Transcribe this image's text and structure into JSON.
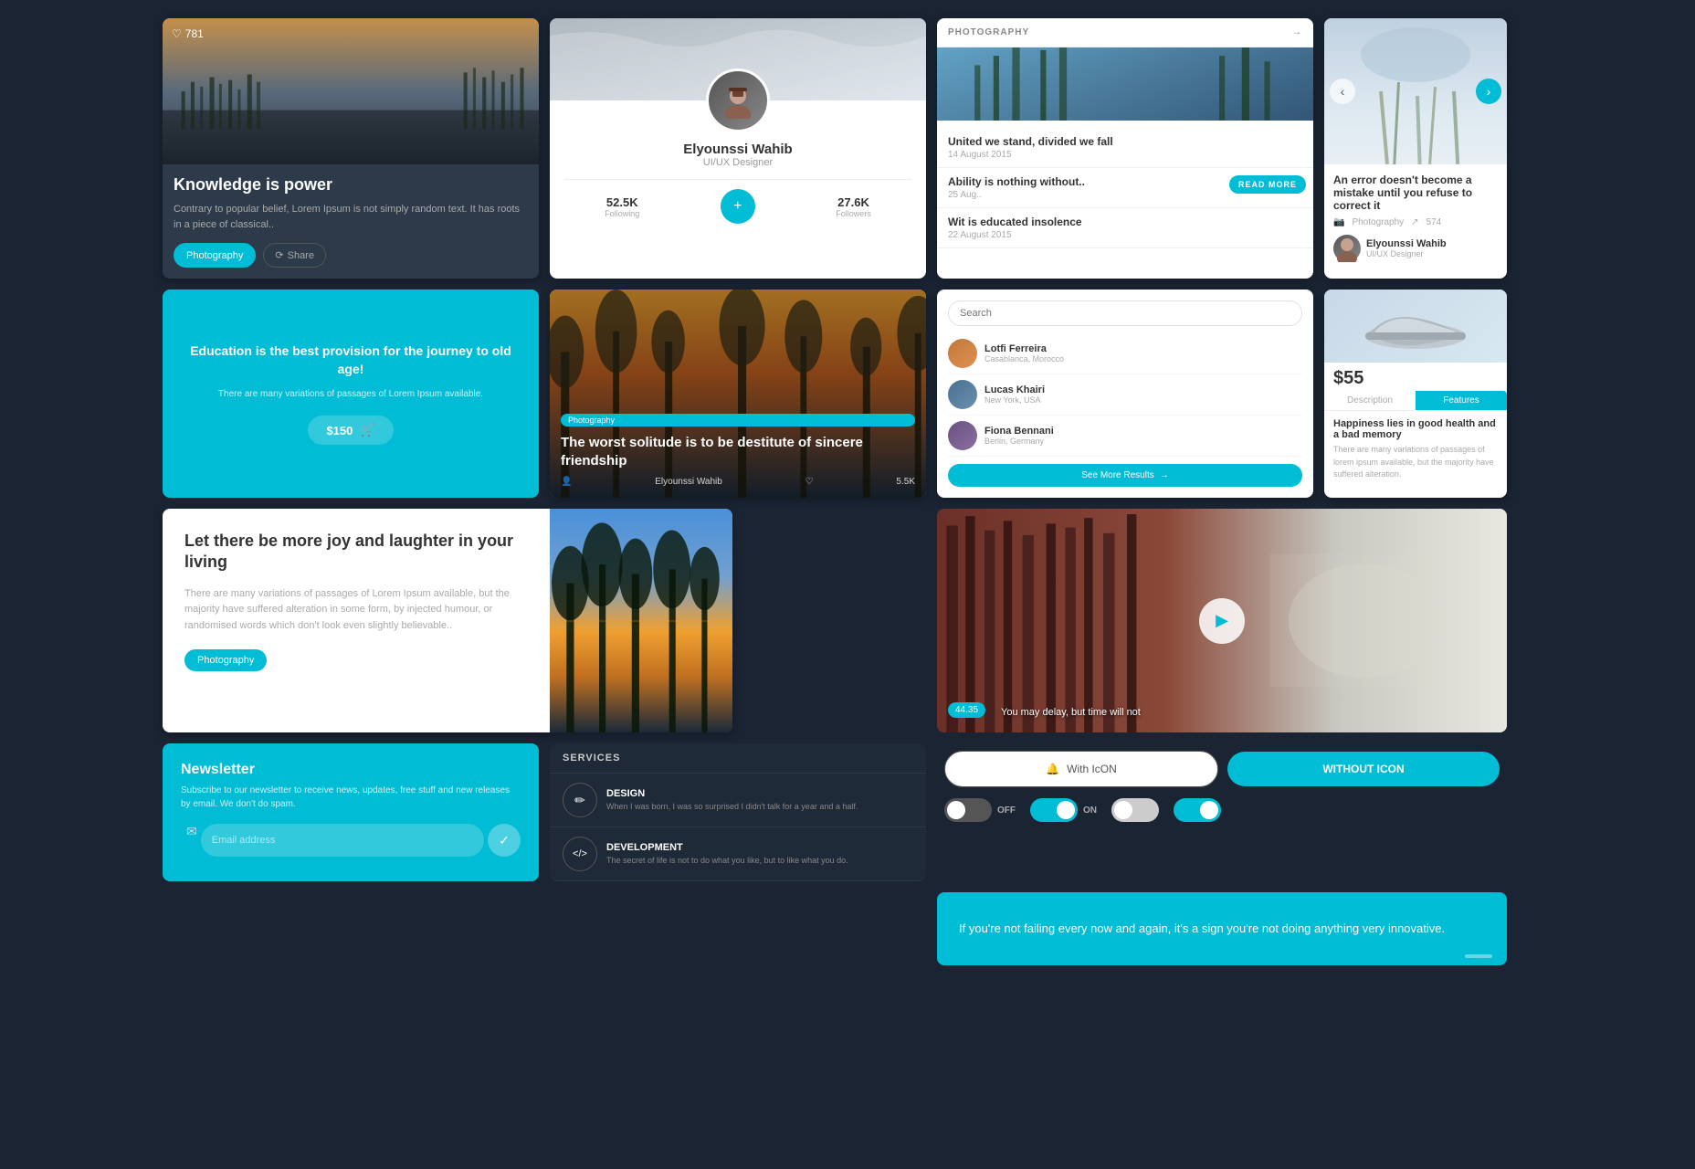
{
  "cards": {
    "knowledge": {
      "heart_count": "781",
      "title": "Knowledge is power",
      "description": "Contrary to popular belief, Lorem Ipsum is not simply random text. It has roots in a piece of classical..",
      "tag_label": "Photography",
      "share_label": "Share"
    },
    "profile": {
      "name": "Elyounssi Wahib",
      "role": "UI/UX Designer",
      "following_count": "52.5K",
      "following_label": "Following",
      "followers_count": "27.6K",
      "followers_label": "Followers"
    },
    "photography": {
      "header": "PHOTOGRAPHY",
      "entries": [
        {
          "title": "United we stand, divided we fall",
          "date": "14 August 2015"
        },
        {
          "title": "Ability is nothing without..",
          "date": "25 Aug.."
        },
        {
          "title": "Wit is educated insolence",
          "date": "22 August 2015"
        }
      ],
      "read_more": "READ MORE"
    },
    "error_card": {
      "title": "An error doesn't become a mistake until you refuse to correct it",
      "category": "Photography",
      "shares": "574",
      "author_name": "Elyounssi Wahib",
      "author_role": "UI/UX Designer"
    },
    "education": {
      "title": "Education is the best provision for the journey to old age!",
      "description": "There are many variations of passages of Lorem Ipsum available.",
      "price": "$150"
    },
    "solitude": {
      "tag": "Photography",
      "title": "The worst solitude is to be destitute of sincere friendship",
      "author": "Elyounssi Wahib",
      "likes": "5.5K"
    },
    "search_card": {
      "placeholder": "Search",
      "users": [
        {
          "name": "Lotfi Ferreira",
          "location": "Casablanca, Morocco"
        },
        {
          "name": "Lucas Khairi",
          "location": "New York, USA"
        },
        {
          "name": "Fiona Bennani",
          "location": "Berlin, Germany"
        }
      ],
      "see_more": "See More Results"
    },
    "product": {
      "price": "$55",
      "tab1": "Description",
      "tab2": "Features",
      "feature_title": "Happiness lies in good health and a bad memory",
      "feature_desc": "There are many variations of passages of lorem ipsum available, but the majority have suffered alteration."
    },
    "joy": {
      "title": "Let there be more joy and laughter in your living",
      "description": "There are many variations of passages of Lorem Ipsum available, but the majority have suffered alteration in some form, by injected humour, or randomised words which don't look even slightly believable..",
      "tag": "Photography"
    },
    "video": {
      "timer": "44.35",
      "caption": "You may delay, but time will not"
    },
    "newsletter": {
      "title": "Newsletter",
      "description": "Subscribe to our newsletter to receive news, updates, free stuff and new releases by email. We don't do spam.",
      "placeholder": "Email address"
    },
    "services": {
      "header": "SERVICES",
      "items": [
        {
          "icon": "✏",
          "title": "DESIGN",
          "desc": "When I was born, I was so surprised I didn't talk for a year and a half."
        },
        {
          "icon": "</>",
          "title": "DEVELOPMENT",
          "desc": "The secret of life is not to do what you like, but to like what you do."
        }
      ]
    },
    "buttons": {
      "with_icon": "With IcON",
      "without_icon": "WITHOUT ICON",
      "off_label": "OFF",
      "on_label": "ON"
    },
    "quote": {
      "text": "If you're not failing every now and again, it's a sign you're not doing anything very innovative."
    }
  }
}
